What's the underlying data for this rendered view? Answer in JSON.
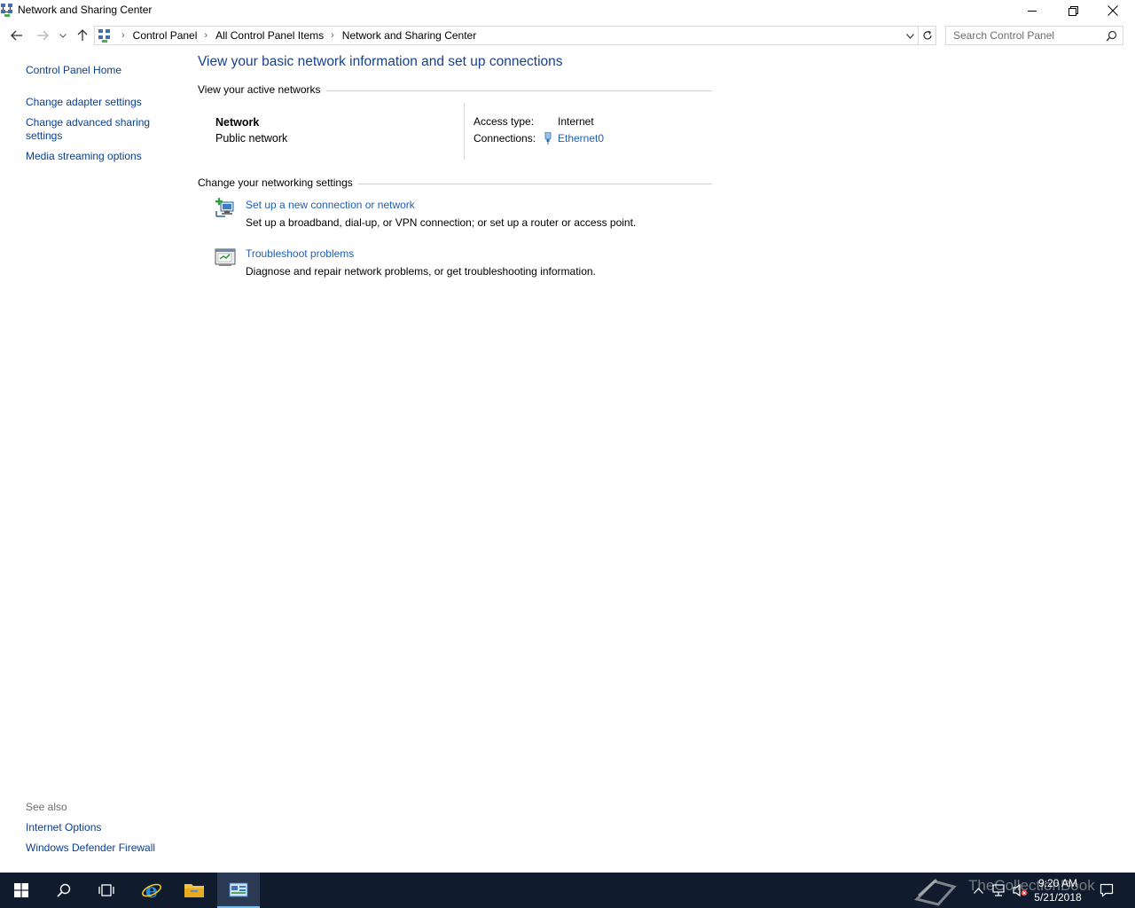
{
  "window": {
    "title": "Network and Sharing Center"
  },
  "address": {
    "crumbs": [
      "Control Panel",
      "All Control Panel Items",
      "Network and Sharing Center"
    ]
  },
  "search": {
    "placeholder": "Search Control Panel"
  },
  "left_nav": {
    "home": "Control Panel Home",
    "items": [
      "Change adapter settings",
      "Change advanced sharing settings",
      "Media streaming options"
    ],
    "see_also_label": "See also",
    "see_also": [
      "Internet Options",
      "Windows Defender Firewall"
    ]
  },
  "main": {
    "heading": "View your basic network information and set up connections",
    "active_networks_label": "View your active networks",
    "network": {
      "name": "Network",
      "type": "Public network",
      "access_type_label": "Access type:",
      "access_type": "Internet",
      "connections_label": "Connections:",
      "connection": "Ethernet0"
    },
    "change_settings_label": "Change your networking settings",
    "tasks": [
      {
        "title": "Set up a new connection or network",
        "description": "Set up a broadband, dial-up, or VPN connection; or set up a router or access point."
      },
      {
        "title": "Troubleshoot problems",
        "description": "Diagnose and repair network problems, or get troubleshooting information."
      }
    ]
  },
  "taskbar": {
    "time": "9:20 AM",
    "date": "5/21/2018",
    "watermark": "TheCollectionBook"
  },
  "colors": {
    "link": "#1c5fb8",
    "heading": "#16418f",
    "taskbar": "#101c2e"
  }
}
